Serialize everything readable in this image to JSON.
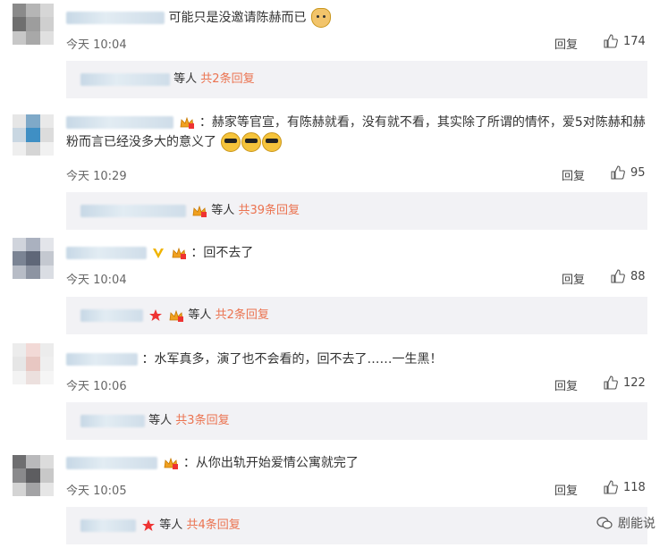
{
  "comments": [
    {
      "text": "可能只是没邀请陈赫而已",
      "time": "今天 10:04",
      "reply": "回复",
      "likes": "174",
      "sub": {
        "suffix": "等人",
        "count": "共2条回复"
      }
    },
    {
      "text": "：赫家等官宣，有陈赫就看，没有就不看，其实除了所谓的情怀，爱5对陈赫和赫粉而言已经没多大的意义了",
      "time": "今天 10:29",
      "reply": "回复",
      "likes": "95",
      "sub": {
        "suffix": "等人",
        "count": "共39条回复"
      }
    },
    {
      "text": "：回不去了",
      "time": "今天 10:04",
      "reply": "回复",
      "likes": "88",
      "sub": {
        "suffix": "等人",
        "count": "共2条回复"
      }
    },
    {
      "text": "：水军真多，演了也不会看的，回不去了……一生黑！",
      "time": "今天 10:06",
      "reply": "回复",
      "likes": "122",
      "sub": {
        "suffix": "等人",
        "count": "共3条回复"
      }
    },
    {
      "text": "：从你出轨开始爱情公寓就完了",
      "time": "今天 10:05",
      "reply": "回复",
      "likes": "118",
      "sub": {
        "suffix": "等人",
        "count": "共4条回复"
      }
    }
  ],
  "watermark": {
    "label": "剧能说"
  },
  "colors": {
    "link": "#eb7350",
    "subBg": "#f2f2f5",
    "badgeRed": "#e33"
  },
  "icons": [
    "thumbs-up-icon",
    "emoji-dog-icon",
    "emoji-sunglasses-icon",
    "vip-crown-icon",
    "verified-v-icon",
    "star-icon",
    "wechat-icon"
  ]
}
